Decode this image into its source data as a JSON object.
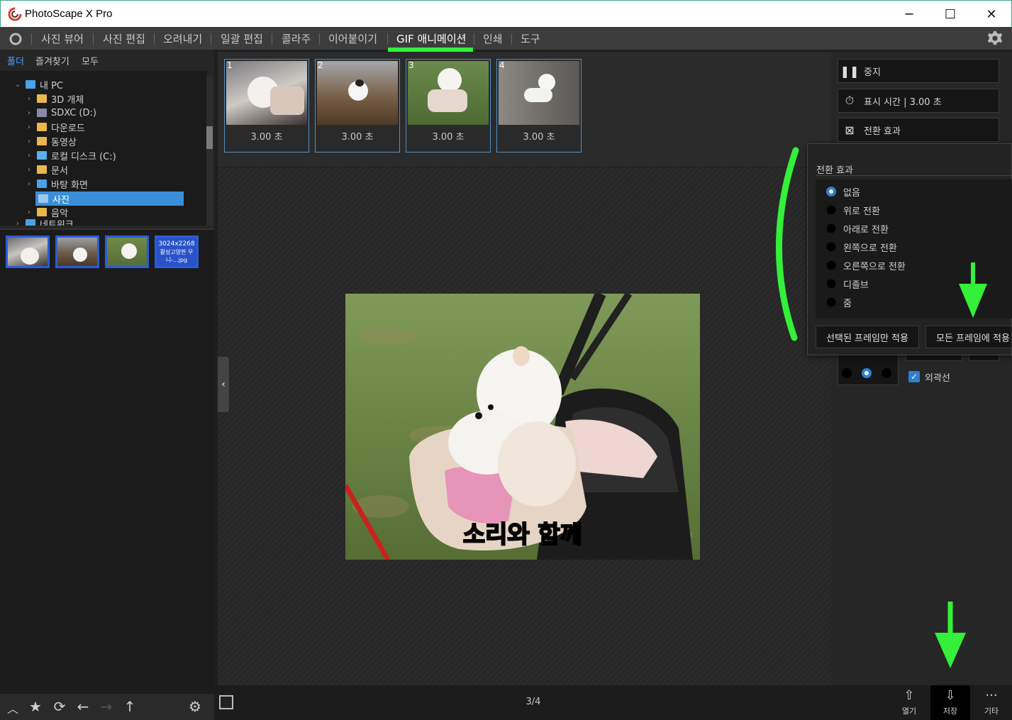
{
  "window": {
    "title": "PhotoScape X Pro",
    "minimize_glyph": "─",
    "maximize_glyph": "☐",
    "close_glyph": "✕"
  },
  "menu": {
    "items": [
      "사진 뷰어",
      "사진 편집",
      "오려내기",
      "일괄 편집",
      "콜라주",
      "이어붙이기",
      "GIF 애니메이션",
      "인쇄",
      "도구"
    ],
    "active": "GIF 애니메이션"
  },
  "left_panel": {
    "tabs": [
      "폴더",
      "즐겨찾기",
      "모두"
    ],
    "tree": {
      "root": "내 PC",
      "items": [
        "3D 개체",
        "SDXC (D:)",
        "다운로드",
        "동영상",
        "로컬 디스크 (C:)",
        "문서",
        "바탕 화면",
        "사진",
        "음악"
      ],
      "selected": "사진",
      "partial": "네트워크"
    },
    "thumb_label": "3024x2268",
    "thumb_filename": "활성고양한 무니-...jpg"
  },
  "frames": [
    {
      "num": "1",
      "duration": "3.00 초"
    },
    {
      "num": "2",
      "duration": "3.00 초"
    },
    {
      "num": "3",
      "duration": "3.00 초"
    },
    {
      "num": "4",
      "duration": "3.00 초"
    }
  ],
  "preview": {
    "caption": "소리와 함께",
    "page_indicator": "3/4"
  },
  "right_panel": {
    "stop_label": "중지",
    "display_time_label": "표시 시간 | 3.00 초",
    "transition_label": "전환 효과",
    "outline_label": "외곽선",
    "outline_checked": true
  },
  "transition_popup": {
    "title": "전환 효과",
    "options": [
      "없음",
      "위로 전환",
      "아래로 전환",
      "왼쪽으로 전환",
      "오른쪽으로 전환",
      "디졸브",
      "줌"
    ],
    "selected": "없음",
    "apply_selected_label": "선택된 프레임만 적용",
    "apply_all_label": "모든 프레임에 적용"
  },
  "bottom": {
    "open_label": "열기",
    "save_label": "저장",
    "more_label": "기타"
  },
  "colors": {
    "accent": "#2f7fd0",
    "annotation_green": "#34f03a",
    "selection": "#3a8fd8"
  }
}
